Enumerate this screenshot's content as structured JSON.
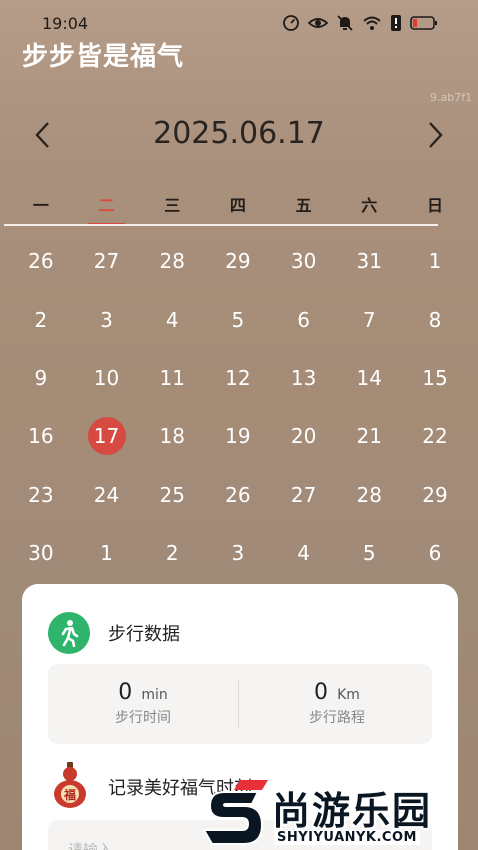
{
  "status_bar": {
    "time": "19:04",
    "icons": [
      "speed-icon",
      "eye-icon",
      "bell-muted-icon",
      "wifi-icon",
      "alert-icon",
      "battery-icon"
    ]
  },
  "app": {
    "title": "步步皆是福气",
    "version": "9.ab7f1"
  },
  "calendar": {
    "date_title": "2025.06.17",
    "weekdays": [
      "一",
      "二",
      "三",
      "四",
      "五",
      "六",
      "日"
    ],
    "today_weekday_index": 1,
    "days": [
      "26",
      "27",
      "28",
      "29",
      "30",
      "31",
      "1",
      "2",
      "3",
      "4",
      "5",
      "6",
      "7",
      "8",
      "9",
      "10",
      "11",
      "12",
      "13",
      "14",
      "15",
      "16",
      "17",
      "18",
      "19",
      "20",
      "21",
      "22",
      "23",
      "24",
      "25",
      "26",
      "27",
      "28",
      "29",
      "30",
      "1",
      "2",
      "3",
      "4",
      "5",
      "6"
    ],
    "selected_index": 22
  },
  "walk_card": {
    "title": "步行数据",
    "time_value": "0",
    "time_unit": "min",
    "time_label": "步行时间",
    "distance_value": "0",
    "distance_unit": "Km",
    "distance_label": "步行路程",
    "record_title": "记录美好福气时刻",
    "record_placeholder": "请输入",
    "gourd_char": "福"
  },
  "watermark": {
    "text": "尚游乐园",
    "url": "SHYIYUANYK.COM"
  },
  "colors": {
    "accent_red": "#d64a41",
    "walk_green": "#2fb46b",
    "background_top": "#b59c88",
    "background_bottom": "#9d8773"
  }
}
